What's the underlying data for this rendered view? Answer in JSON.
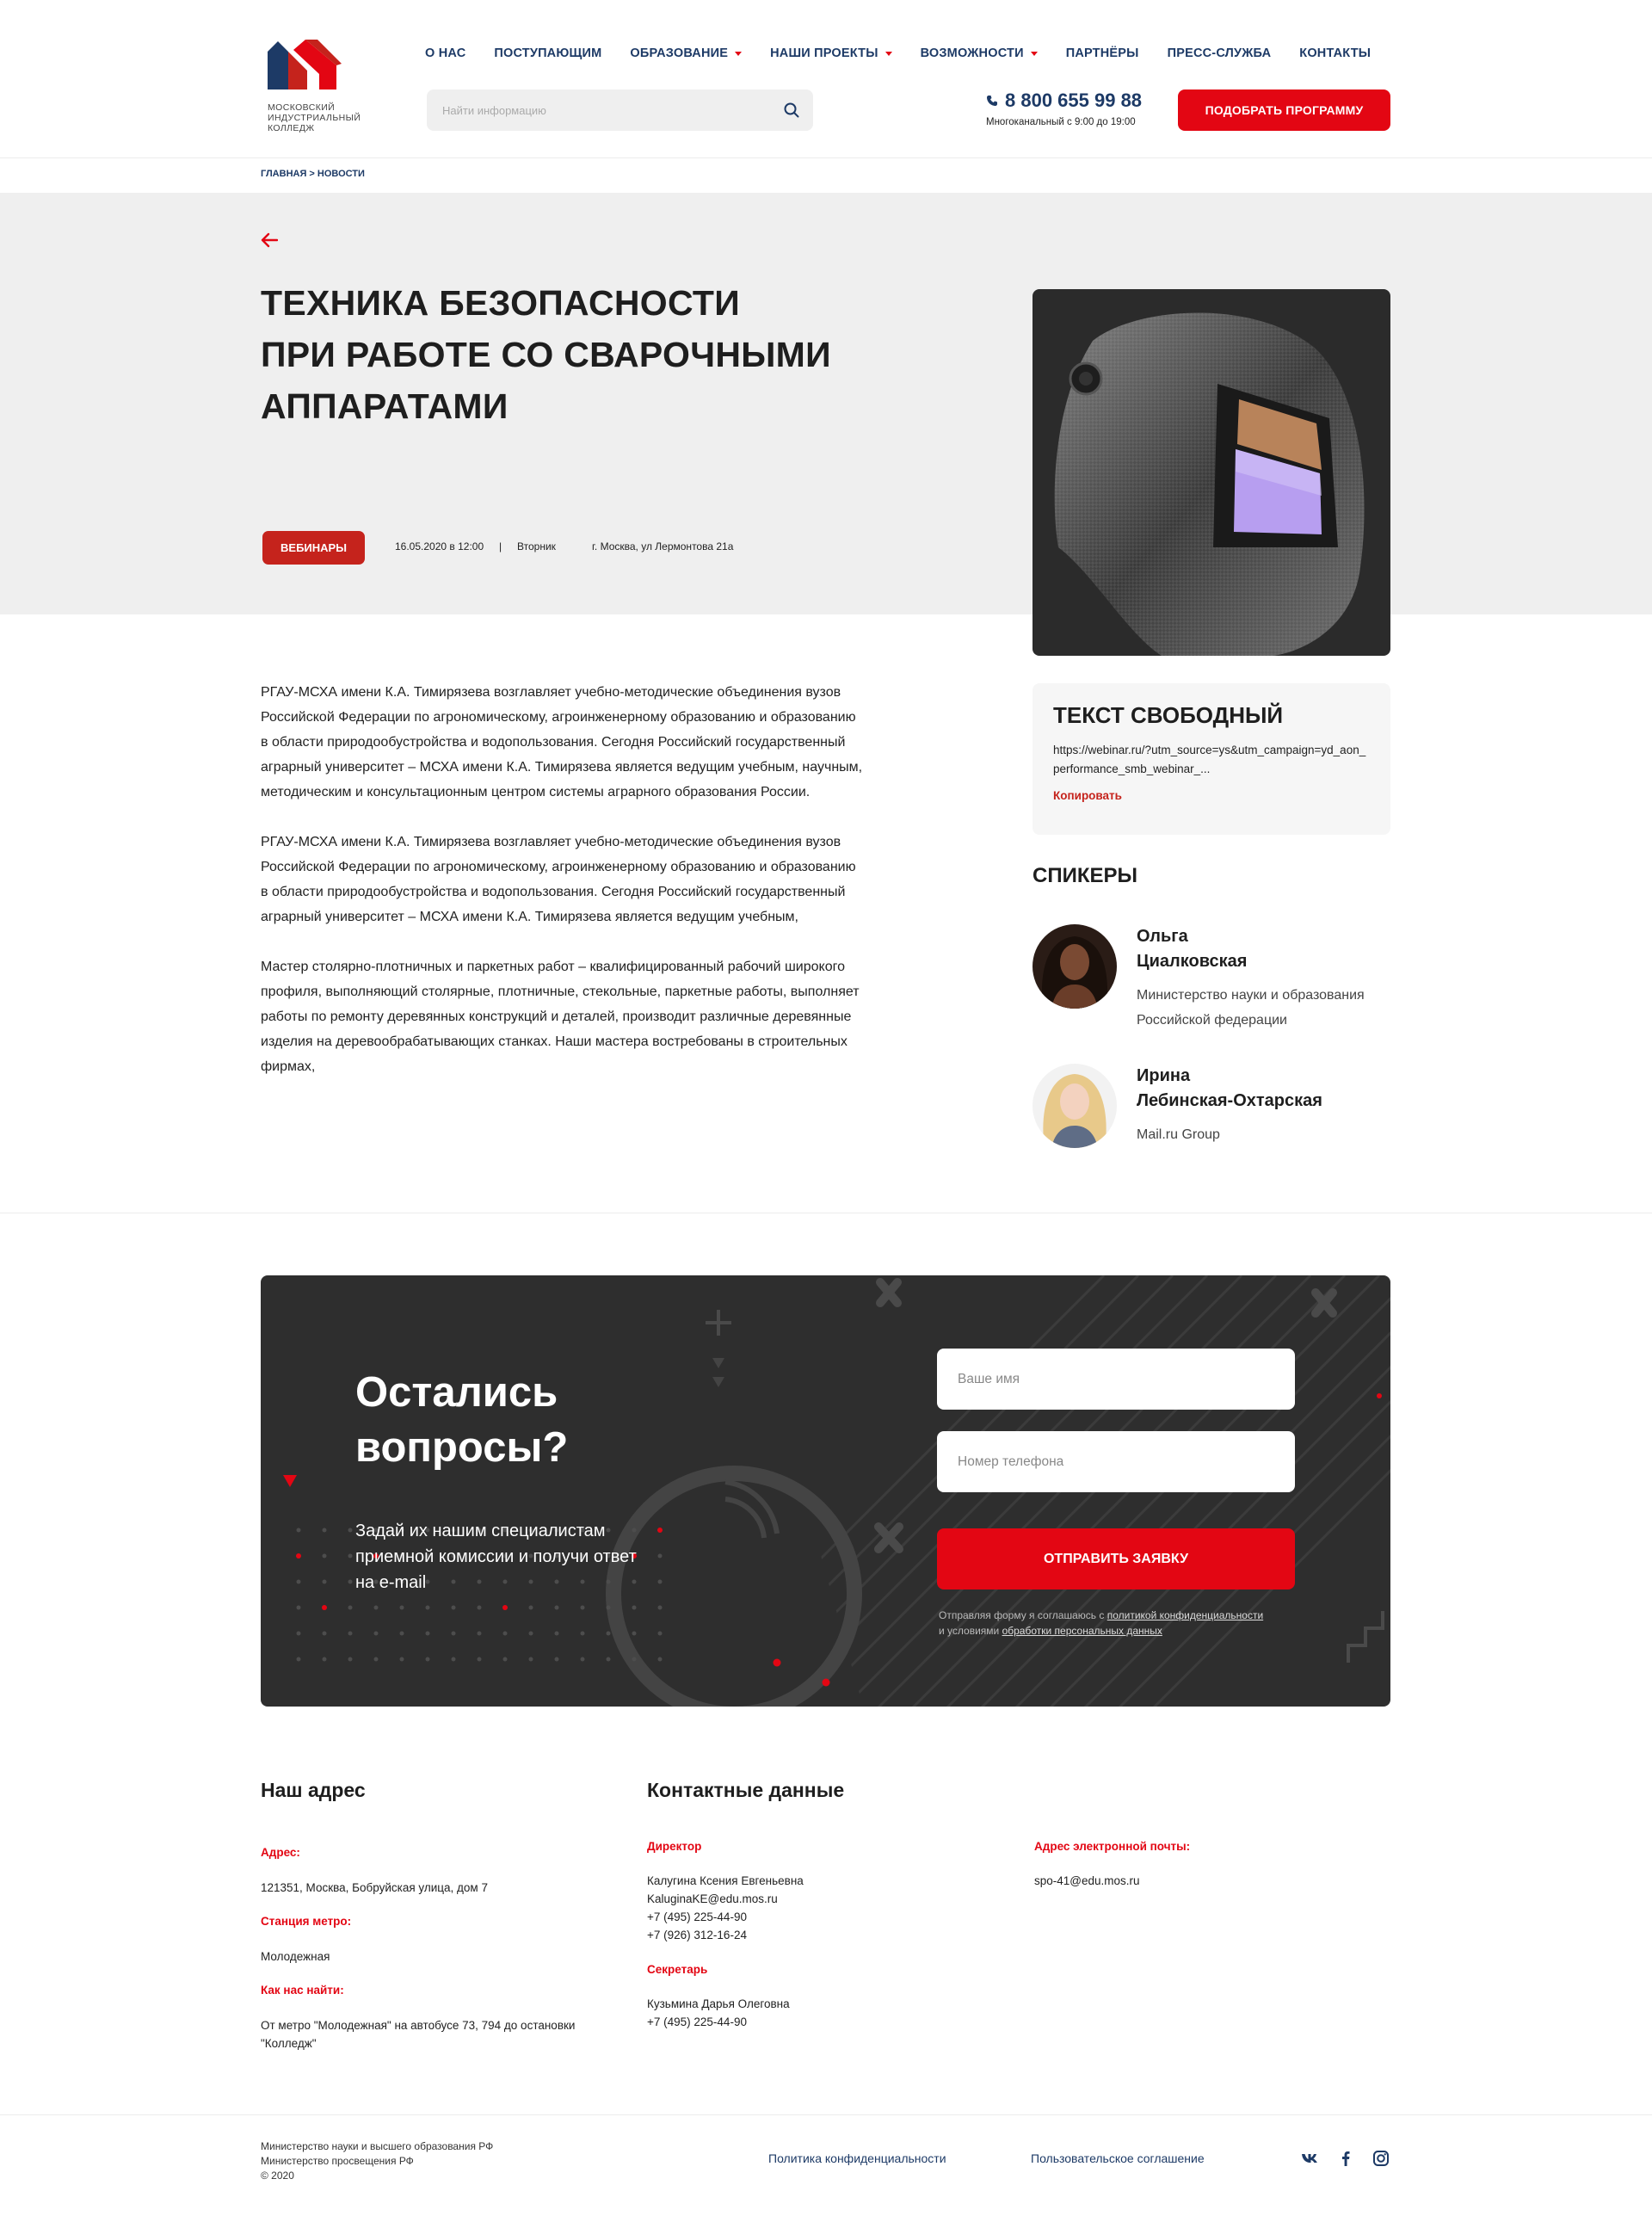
{
  "header": {
    "logo_lines": [
      "Московский",
      "индустриальный",
      "колледж"
    ],
    "nav": [
      {
        "label": "О нас",
        "dropdown": false
      },
      {
        "label": "Поступающим",
        "dropdown": false
      },
      {
        "label": "Образование",
        "dropdown": true
      },
      {
        "label": "Наши проекты",
        "dropdown": true
      },
      {
        "label": "Возможности",
        "dropdown": true
      },
      {
        "label": "Партнёры",
        "dropdown": false
      },
      {
        "label": "Пресс-служба",
        "dropdown": false
      },
      {
        "label": "Контакты",
        "dropdown": false
      }
    ],
    "search_placeholder": "Найти информацию",
    "phone": "8 800 655 99 88",
    "phone_note": "Многоканальный с 9:00 до 19:00",
    "cta_label": "Подобрать программу"
  },
  "breadcrumb": "Главная > Новости",
  "event": {
    "title_lines": [
      "Техника безопасности",
      "при работе со сварочными",
      "аппаратами"
    ],
    "badge": "Вебинары",
    "date": "16.05.2020 в 12:00",
    "separator": "|",
    "weekday": "Вторник",
    "location": "г. Москва, ул Лермонтова 21а",
    "paragraphs": [
      "РГАУ-МСХА имени К.А. Тимирязева возглавляет учебно-методические объединения вузов Российской Федерации по агрономическому, агроинженерному образованию и образованию в области природообустройства и водопользования. Сегодня Российский государственный аграрный университет – МСХА имени К.А. Тимирязева является ведущим учебным, научным, методическим и консультационным центром системы аграрного образования России.",
      "РГАУ-МСХА имени К.А. Тимирязева возглавляет учебно-методические объединения вузов Российской Федерации по агрономическому, агроинженерному образованию и образованию в области природообустройства и водопользования. Сегодня Российский государственный аграрный университет – МСХА имени К.А. Тимирязева является ведущим учебным,",
      "Мастер столярно-плотничных и паркетных работ – квалифицированный рабочий широкого профиля, выполняющий столярные, плотничные, стекольные, паркетные работы, выполняет работы по ремонту деревянных конструкций и деталей, производит различные деревянные изделия на деревообрабатывающих станках. Наши мастера востребованы в строительных фирмах,"
    ]
  },
  "free_text": {
    "title": "Текст свободный",
    "link": "https://webinar.ru/?utm_source=ys&utm_campaign=yd_aon_performance_smb_webinar_...",
    "copy_label": "Копировать"
  },
  "speakers": {
    "title": "Спикеры",
    "items": [
      {
        "first": "Ольга",
        "last": "Циалковская",
        "org": "Министерство науки и образования Российской федерации"
      },
      {
        "first": "Ирина",
        "last": "Лебинская-Охтарская",
        "org": "Mail.ru Group"
      }
    ]
  },
  "cta": {
    "title": "Остались вопросы?",
    "subtitle": "Задай их нашим специалистам приемной комиссии и получи ответ на e-mail",
    "name_placeholder": "Ваше имя",
    "phone_placeholder": "Номер телефона",
    "submit_label": "Отправить заявку",
    "note_prefix": "Отправляя форму я соглашаюсь с ",
    "note_link1": "политикой конфиденциальности",
    "note_middle": " и условиями ",
    "note_link2": "обработки персональных данных"
  },
  "footer": {
    "address_title": "Наш адрес",
    "address_label": "Адрес:",
    "address": "121351, Москва, Бобруйская улица, дом 7",
    "metro_label": "Станция метро:",
    "metro": "Молодежная",
    "route_label": "Как нас найти:",
    "route": "От метро \"Молодежная\" на автобусе 73, 794 до остановки \"Колледж\"",
    "contacts_title": "Контактные данные",
    "director_label": "Директор",
    "director_lines": [
      "Калугина Ксения Евгеньевна",
      "KaluginaKE@edu.mos.ru",
      "+7 (495) 225-44-90",
      "+7 (926) 312-16-24"
    ],
    "secretary_label": "Секретарь",
    "secretary_lines": [
      "Кузьмина Дарья Олеговна",
      "+7 (495) 225-44-90"
    ],
    "email_label": "Адрес электронной почты:",
    "email": "spo-41@edu.mos.ru",
    "bottom_lines": [
      "Министерство науки и высшего образования РФ",
      "Министерство просвещения РФ",
      "© 2020"
    ],
    "privacy": "Политика конфиденциальности",
    "agreement": "Пользовательское соглашение",
    "social": [
      "vk-icon",
      "facebook-icon",
      "instagram-icon"
    ]
  },
  "colors": {
    "accent": "#e30613",
    "navy": "#1d3a66",
    "badge": "#c5231c",
    "dark": "#2e2e2e"
  }
}
